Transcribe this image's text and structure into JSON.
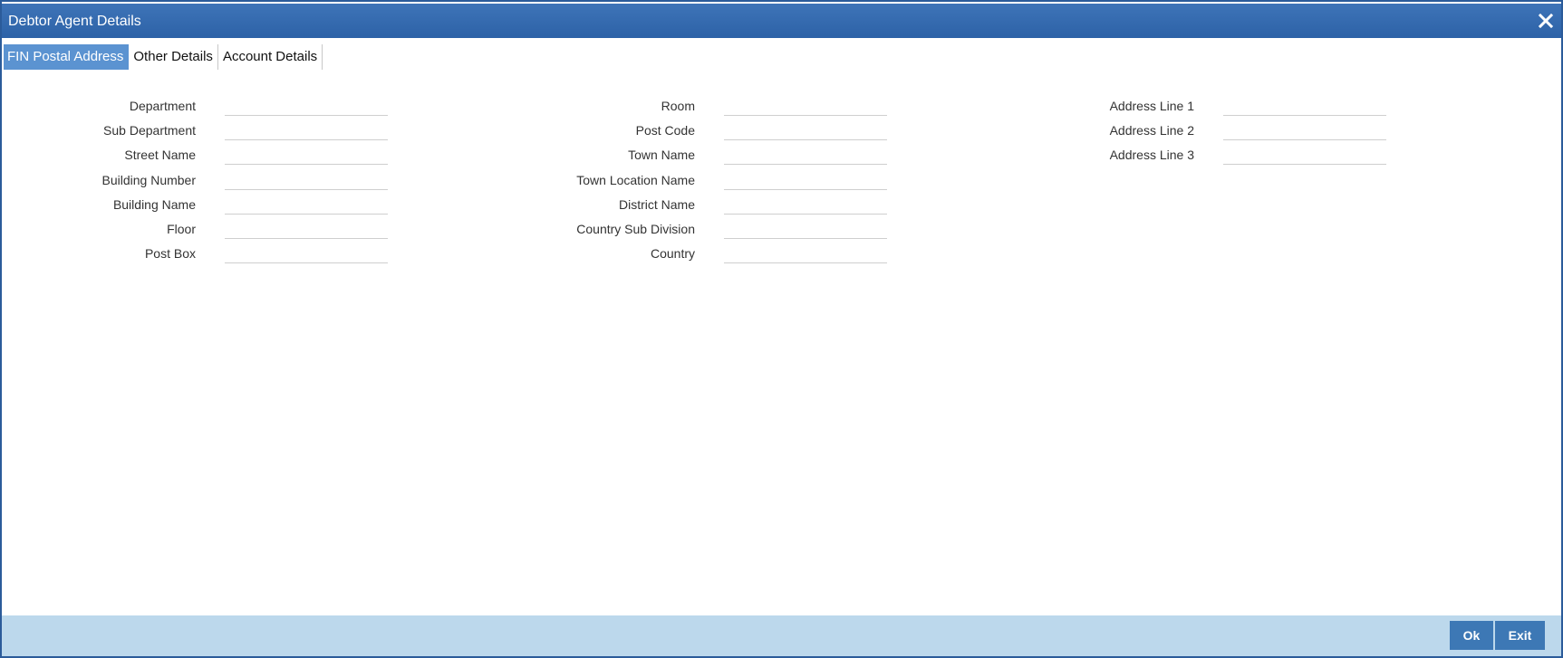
{
  "window": {
    "title": "Debtor Agent Details",
    "close_icon": "close-icon"
  },
  "tabs": [
    {
      "label": "FIN Postal Address",
      "active": true
    },
    {
      "label": "Other Details",
      "active": false
    },
    {
      "label": "Account Details",
      "active": false
    }
  ],
  "fields": {
    "col1": [
      {
        "label": "Department",
        "value": ""
      },
      {
        "label": "Sub Department",
        "value": ""
      },
      {
        "label": "Street Name",
        "value": ""
      },
      {
        "label": "Building Number",
        "value": ""
      },
      {
        "label": "Building Name",
        "value": ""
      },
      {
        "label": "Floor",
        "value": ""
      },
      {
        "label": "Post Box",
        "value": ""
      }
    ],
    "col2": [
      {
        "label": "Room",
        "value": ""
      },
      {
        "label": "Post Code",
        "value": ""
      },
      {
        "label": "Town Name",
        "value": ""
      },
      {
        "label": "Town Location Name",
        "value": ""
      },
      {
        "label": "District Name",
        "value": ""
      },
      {
        "label": "Country Sub Division",
        "value": ""
      },
      {
        "label": "Country",
        "value": ""
      }
    ],
    "col3": [
      {
        "label": "Address Line 1",
        "value": ""
      },
      {
        "label": "Address Line 2",
        "value": ""
      },
      {
        "label": "Address Line 3",
        "value": ""
      }
    ]
  },
  "footer": {
    "ok_label": "Ok",
    "exit_label": "Exit"
  },
  "colors": {
    "titlebar": "#2d62a7",
    "active_tab": "#5b93d1",
    "footer": "#bcd8ec",
    "button": "#3d78b5"
  }
}
